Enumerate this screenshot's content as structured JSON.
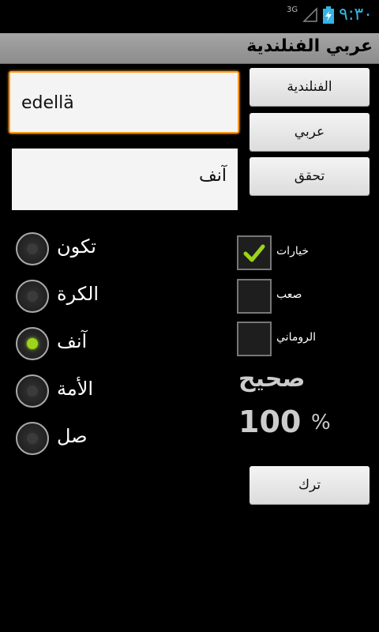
{
  "status_bar": {
    "network": "3G",
    "time": "٩:٣٠",
    "signal_icon": "signal-icon",
    "battery_icon": "battery-charging-icon"
  },
  "title": "عربي الفنلندية",
  "input": {
    "value": "edellä"
  },
  "answer": {
    "value": "آنف"
  },
  "buttons": {
    "finnish": "الفنلندية",
    "arabic": "عربي",
    "check": "تحقق",
    "leave": "ترك"
  },
  "choices": [
    {
      "label": "تكون",
      "checked": false
    },
    {
      "label": "الكرة",
      "checked": false
    },
    {
      "label": "آنف",
      "checked": true
    },
    {
      "label": "الأمة",
      "checked": false
    },
    {
      "label": "صل",
      "checked": false
    }
  ],
  "options": [
    {
      "label": "خيارات",
      "checked": true
    },
    {
      "label": "صعب",
      "checked": false
    },
    {
      "label": "الروماني",
      "checked": false
    }
  ],
  "score": {
    "label": "صحيح",
    "value": "100",
    "unit": "%"
  },
  "colors": {
    "accent_green": "#9bd41a",
    "focus_orange": "#ff9a1a",
    "status_blue": "#33b5e5"
  }
}
